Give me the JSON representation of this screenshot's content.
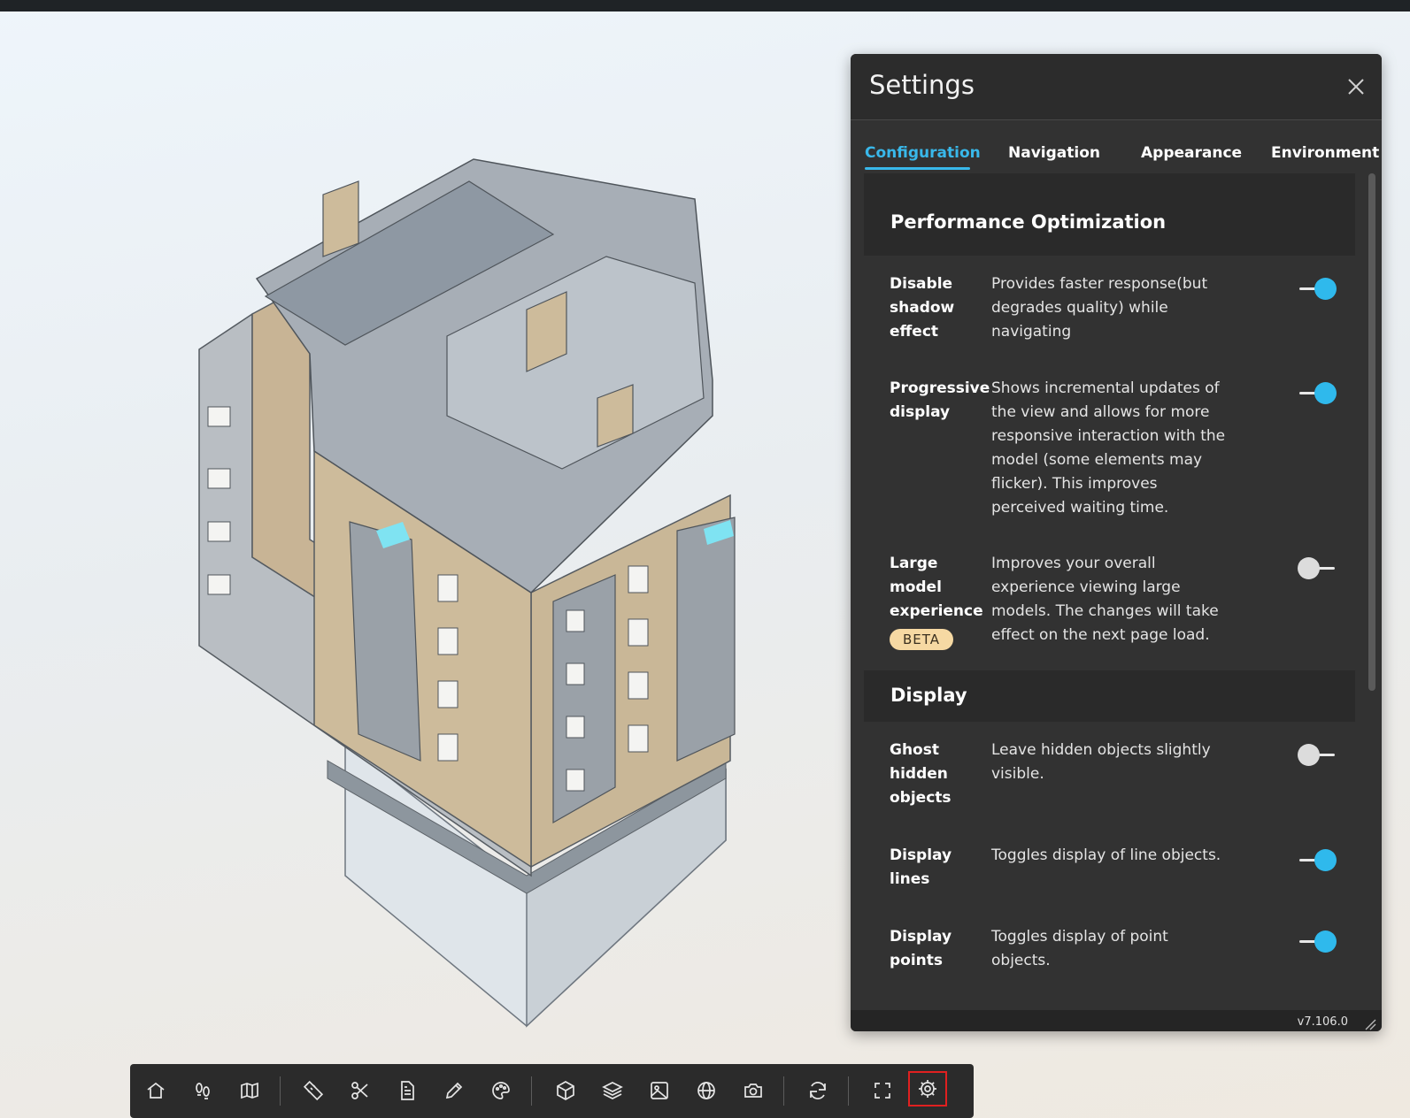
{
  "settings_panel": {
    "title": "Settings",
    "tabs": [
      "Configuration",
      "Navigation",
      "Appearance",
      "Environment"
    ],
    "active_tab": "Configuration",
    "sections": {
      "performance": {
        "title": "Performance Optimization",
        "rows": [
          {
            "label": "Disable shadow effect",
            "description": "Provides faster response(but degrades quality) while navigating",
            "enabled": true
          },
          {
            "label": "Progressive display",
            "description": "Shows incremental updates of the view and allows for more responsive interaction with the model (some elements may flicker). This improves perceived waiting time.",
            "enabled": true
          },
          {
            "label": "Large model experience",
            "description": "Improves your overall experience viewing large models. The changes will take effect on the next page load.",
            "enabled": false,
            "badge": "BETA"
          }
        ]
      },
      "display": {
        "title": "Display",
        "rows": [
          {
            "label": "Ghost hidden objects",
            "description": "Leave hidden objects slightly visible.",
            "enabled": false
          },
          {
            "label": "Display lines",
            "description": "Toggles display of line objects.",
            "enabled": true
          },
          {
            "label": "Display points",
            "description": "Toggles display of point objects.",
            "enabled": true
          }
        ]
      }
    },
    "version": "v7.106.0"
  },
  "toolbar": {
    "tools": [
      "home-icon",
      "footprints-icon",
      "map-icon",
      "ruler-icon",
      "scissors-icon",
      "document-icon",
      "pencil-icon",
      "palette-icon",
      "cube-icon",
      "layers-icon",
      "image-icon",
      "globe-icon",
      "camera-icon",
      "refresh-icon",
      "fullscreen-icon",
      "gear-icon"
    ],
    "active_tool": "gear-icon"
  },
  "colors": {
    "accent": "#2fb9ec",
    "panel_bg": "#323232",
    "toolbar_bg": "#2b2b2b",
    "beta_badge": "#f6d9a3",
    "active_tool_border": "#e02020"
  }
}
